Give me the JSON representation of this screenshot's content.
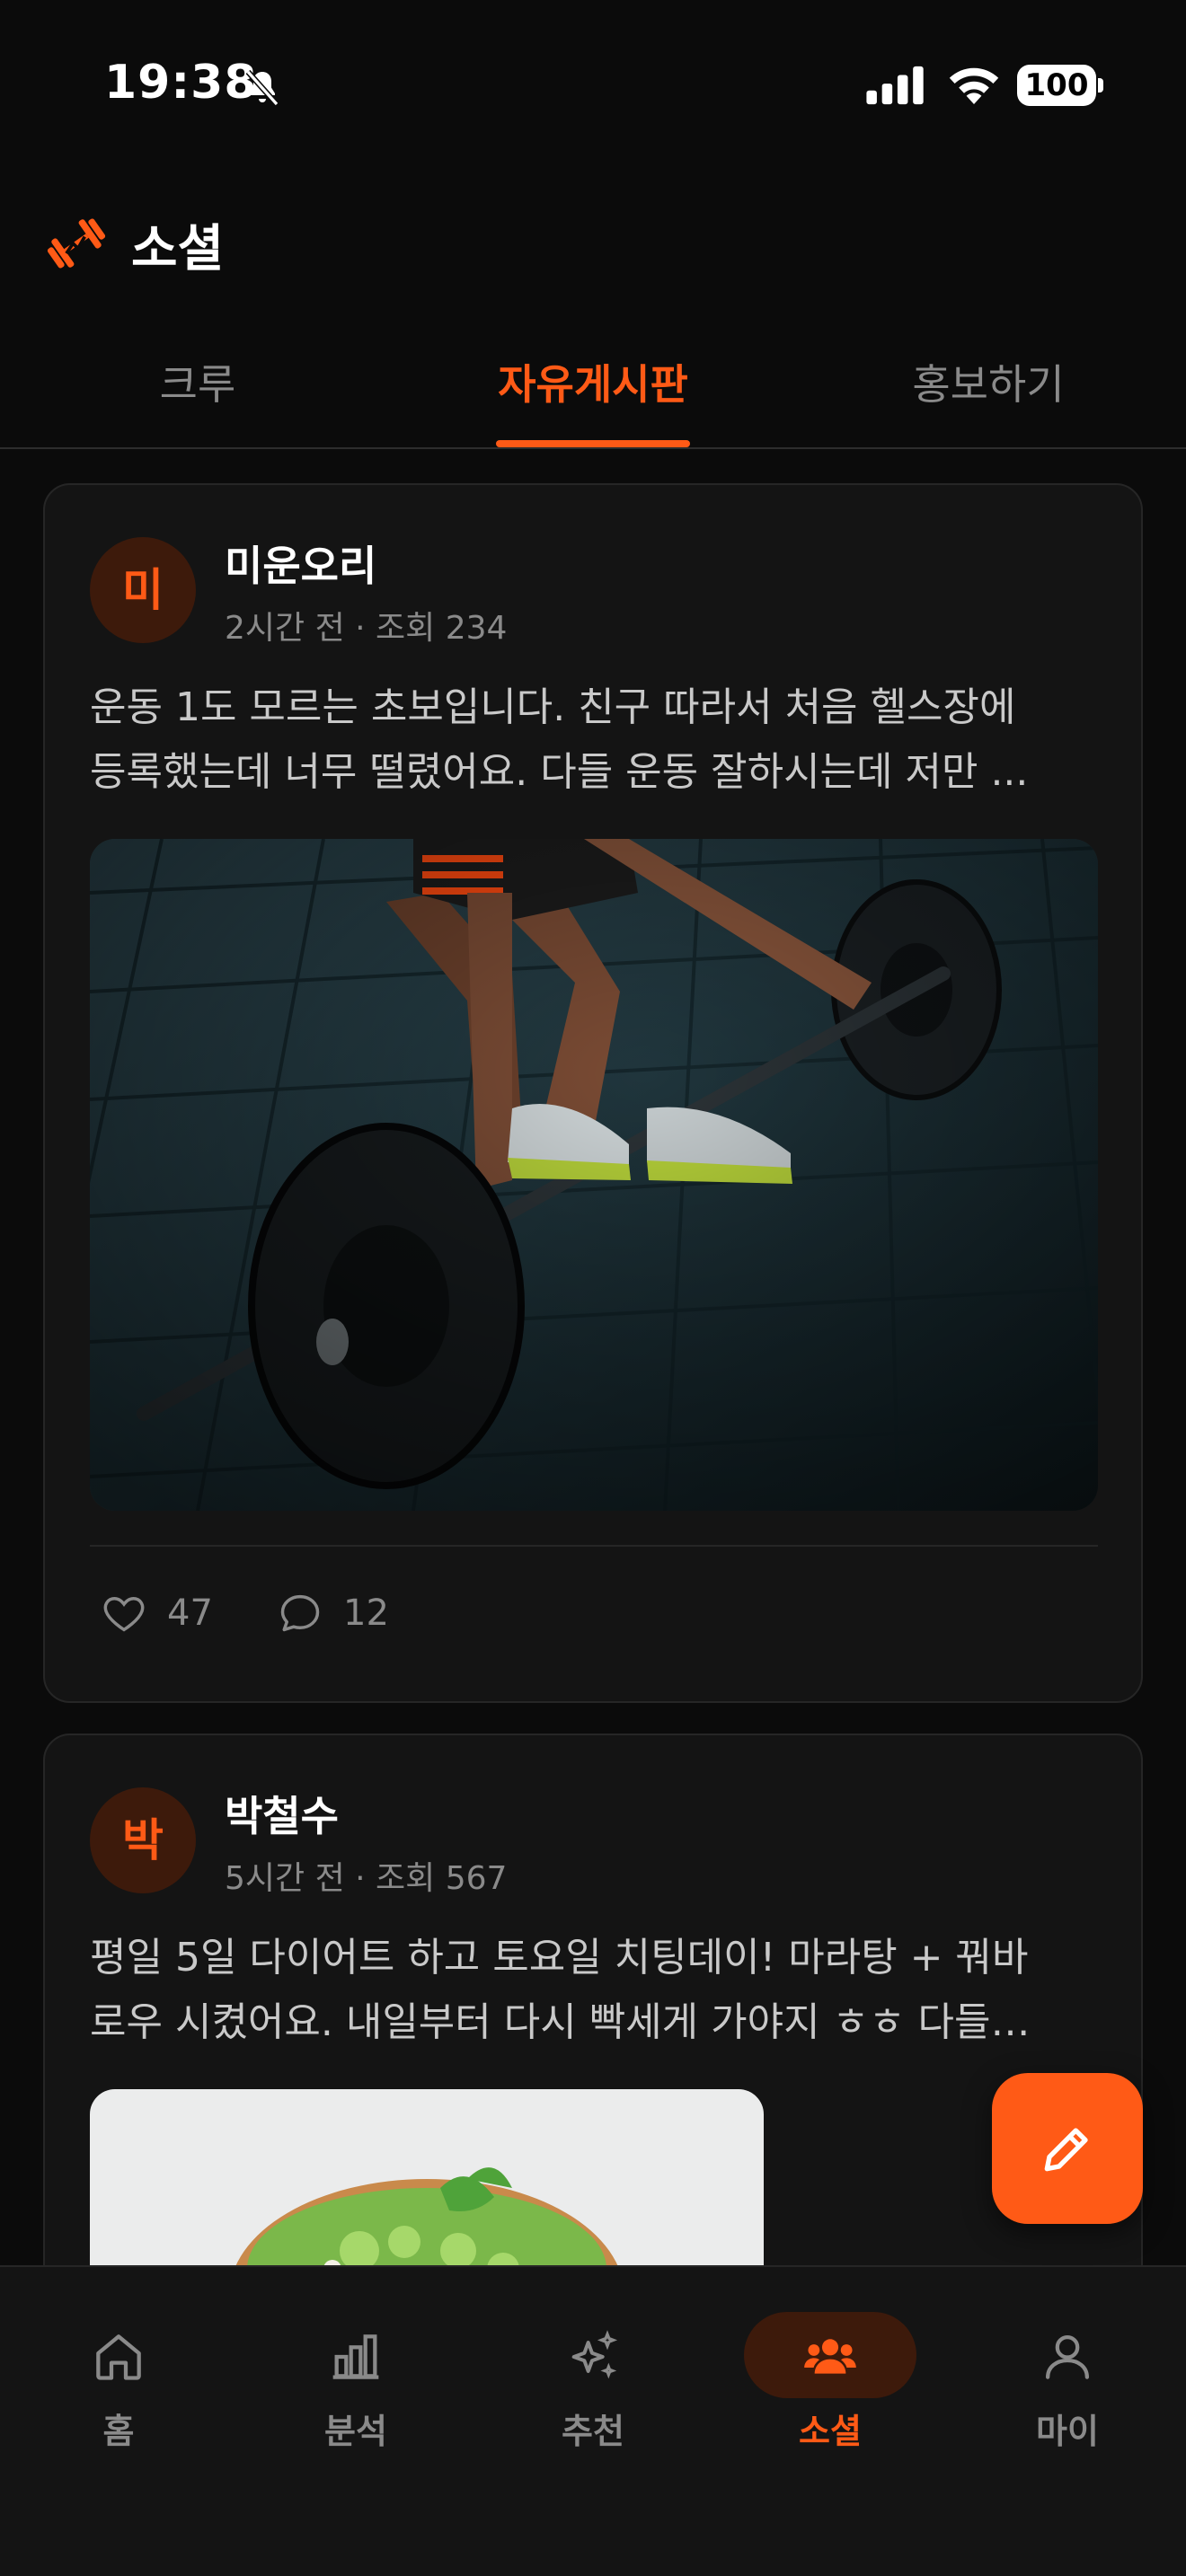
{
  "status_bar": {
    "time": "19:38",
    "battery": "100",
    "icons": [
      "bell-off-icon",
      "signal-icon",
      "wifi-icon",
      "battery-icon"
    ]
  },
  "header": {
    "title": "소셜",
    "logo_icon": "dumbbell-icon"
  },
  "tabs": [
    {
      "label": "크루",
      "active": false
    },
    {
      "label": "자유게시판",
      "active": true
    },
    {
      "label": "홍보하기",
      "active": false
    }
  ],
  "posts": [
    {
      "avatar_initial": "미",
      "author": "미운오리",
      "meta": "2시간 전 · 조회 234",
      "text_line1": "운동 1도 모르는 초보입니다. 친구 따라서 처음 헬스장에",
      "text_line2": "등록했는데 너무 떨렸어요. 다들 운동 잘하시는데 저만 ...",
      "image": "barbell-deadlift-photo",
      "likes": "47",
      "comments": "12"
    },
    {
      "avatar_initial": "박",
      "author": "박철수",
      "meta": "5시간 전 · 조회 567",
      "text_line1": "평일 5일 다이어트 하고 토요일 치팅데이! 마라탕 + 꿔바",
      "text_line2": "로우 시켰어요. 내일부터 다시 빡세게 가야지 ㅎㅎ 다들…",
      "image": "salad-bowl-photo"
    }
  ],
  "fab": {
    "icon": "pencil-icon"
  },
  "bottom_nav": [
    {
      "label": "홈",
      "icon": "home-icon",
      "active": false
    },
    {
      "label": "분석",
      "icon": "bar-chart-icon",
      "active": false
    },
    {
      "label": "추천",
      "icon": "sparkle-icon",
      "active": false
    },
    {
      "label": "소셜",
      "icon": "people-icon",
      "active": true
    },
    {
      "label": "마이",
      "icon": "person-icon",
      "active": false
    }
  ],
  "colors": {
    "accent": "#ff5a16",
    "background": "#0b0b0b",
    "card": "#141414",
    "muted_text": "#8a8a8a"
  }
}
